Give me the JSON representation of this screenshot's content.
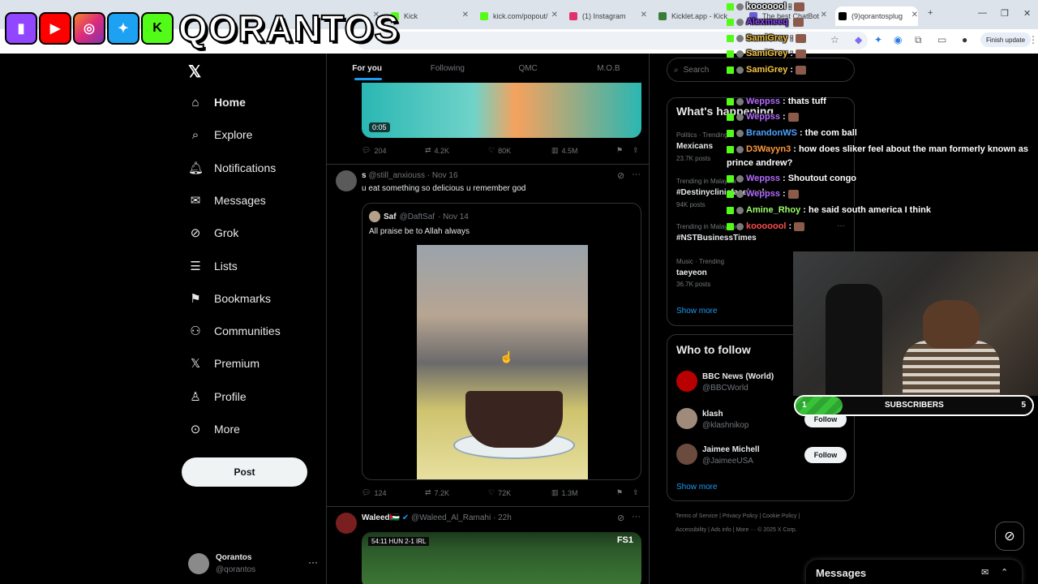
{
  "browser": {
    "tabs": [
      {
        "label": "",
        "color": "#1d9bf0"
      },
      {
        "label": "Kick",
        "color": "#53fc18"
      },
      {
        "label": "kick.com/popout/",
        "color": "#53fc18"
      },
      {
        "label": "(1) Instagram",
        "color": "#e1306c"
      },
      {
        "label": "Kicklet.app - Kick",
        "color": "#3a7d3a"
      },
      {
        "label": "The best ChatBot",
        "color": "#6b5bd6"
      },
      {
        "label": "(9)qorantosplug",
        "color": "#000000"
      }
    ],
    "finish_update": "Finish update"
  },
  "overlay": {
    "brand": "QORANTOS",
    "platform_icons": [
      "twitch-icon",
      "youtube-icon",
      "instagram-icon",
      "twitter-icon",
      "kick-icon"
    ]
  },
  "sidebar": {
    "items": [
      {
        "label": "Home",
        "icon": "home-icon"
      },
      {
        "label": "Explore",
        "icon": "search-icon"
      },
      {
        "label": "Notifications",
        "icon": "bell-icon"
      },
      {
        "label": "Messages",
        "icon": "mail-icon"
      },
      {
        "label": "Grok",
        "icon": "grok-icon"
      },
      {
        "label": "Lists",
        "icon": "list-icon"
      },
      {
        "label": "Bookmarks",
        "icon": "bookmark-icon"
      },
      {
        "label": "Communities",
        "icon": "communities-icon"
      },
      {
        "label": "Premium",
        "icon": "x-icon"
      },
      {
        "label": "Profile",
        "icon": "person-icon"
      },
      {
        "label": "More",
        "icon": "more-circle-icon"
      }
    ],
    "post_label": "Post",
    "account": {
      "name": "Qorantos",
      "handle": "@qorantos"
    }
  },
  "feed": {
    "tabs": [
      "For you",
      "Following",
      "QMC",
      "M.O.B"
    ],
    "post1": {
      "duration": "0:05",
      "replies": "204",
      "reposts": "4.2K",
      "likes": "80K",
      "views": "4.5M"
    },
    "post2": {
      "name": "s",
      "handle": "@still_anxiouss",
      "date": "· Nov 16",
      "text": "u eat something so delicious u remember god",
      "quote": {
        "name": "Saf",
        "handle": "@DaftSaf",
        "date": "· Nov 14",
        "text": "All praise be to Allah always"
      },
      "replies": "124",
      "reposts": "7.2K",
      "likes": "72K",
      "views": "1.3M"
    },
    "post3": {
      "name": "Waleed🇵🇸",
      "handle": "@Waleed_Al_Ramahi",
      "date": "· 22h",
      "score": "54:11  HUN 2-1 IRL",
      "channel": "FS1"
    }
  },
  "right": {
    "search_placeholder": "Search",
    "happening_title": "What's happening",
    "trends": [
      {
        "category": "Politics · Trending",
        "title": "Mexicans",
        "posts": "23.7K posts"
      },
      {
        "category": "Trending in Malaysia",
        "title": "#Destinyclinicfacebook",
        "posts": "94K posts"
      },
      {
        "category": "Trending in Malaysia",
        "title": "#NSTBusinessTimes",
        "posts": ""
      },
      {
        "category": "Music · Trending",
        "title": "taeyeon",
        "posts": "36.7K posts"
      }
    ],
    "show_more": "Show more",
    "wtf_title": "Who to follow",
    "follows": [
      {
        "name": "BBC News (World)",
        "handle": "@BBCWorld",
        "button": ""
      },
      {
        "name": "klash",
        "handle": "@klashnikop",
        "button": "Follow"
      },
      {
        "name": "Jaimee Michell",
        "handle": "@JaimeeUSA",
        "button": "Follow"
      }
    ],
    "wtf_show_more": "Show more",
    "footer1": "Terms of Service  |  Privacy Policy  |  Cookie Policy  |",
    "footer2": "Accessibility  |  Ads info  |  More ···  © 2025 X Corp."
  },
  "chat": [
    {
      "user": "kooooool",
      "msg": ":",
      "color": "#ffffff",
      "emote": true
    },
    {
      "user": "Alexmeeq",
      "msg": "",
      "color": "#9146ff",
      "emote": true
    },
    {
      "user": "SamiGrey",
      "msg": ":",
      "color": "#f5c542",
      "emote": true
    },
    {
      "user": "SamiGrey",
      "msg": ":",
      "color": "#f5c542",
      "emote": true
    },
    {
      "user": "SamiGrey",
      "msg": ":",
      "color": "#f5c542",
      "emote": true
    },
    {
      "user": "Weppss",
      "msg": ": thats tuff",
      "color": "#b36bff",
      "emote": false
    },
    {
      "user": "Weppss",
      "msg": ":",
      "color": "#b36bff",
      "emote": true
    },
    {
      "user": "BrandonWS",
      "msg": ": the com ball",
      "color": "#4fa3ff",
      "emote": false
    },
    {
      "user": "D3Wayyn3",
      "msg": ": how does sliker feel about the man formerly known as",
      "color": "#ff9a3c",
      "emote": false
    },
    {
      "user": "",
      "msg": "prince andrew?",
      "color": "#ffffff",
      "emote": false
    },
    {
      "user": "Weppss",
      "msg": ": Shoutout congo",
      "color": "#b36bff",
      "emote": false
    },
    {
      "user": "Weppss",
      "msg": ":",
      "color": "#b36bff",
      "emote": true
    },
    {
      "user": "Amine_Rhoy",
      "msg": ": he said south america I think",
      "color": "#9cff6a",
      "emote": false
    },
    {
      "user": "kooooool",
      "msg": ":",
      "color": "#ff4d4d",
      "emote": true
    }
  ],
  "subgoal": {
    "current": "1",
    "label": "SUBSCRIBERS",
    "target": "5",
    "progress": 0.2
  },
  "messages_label": "Messages"
}
